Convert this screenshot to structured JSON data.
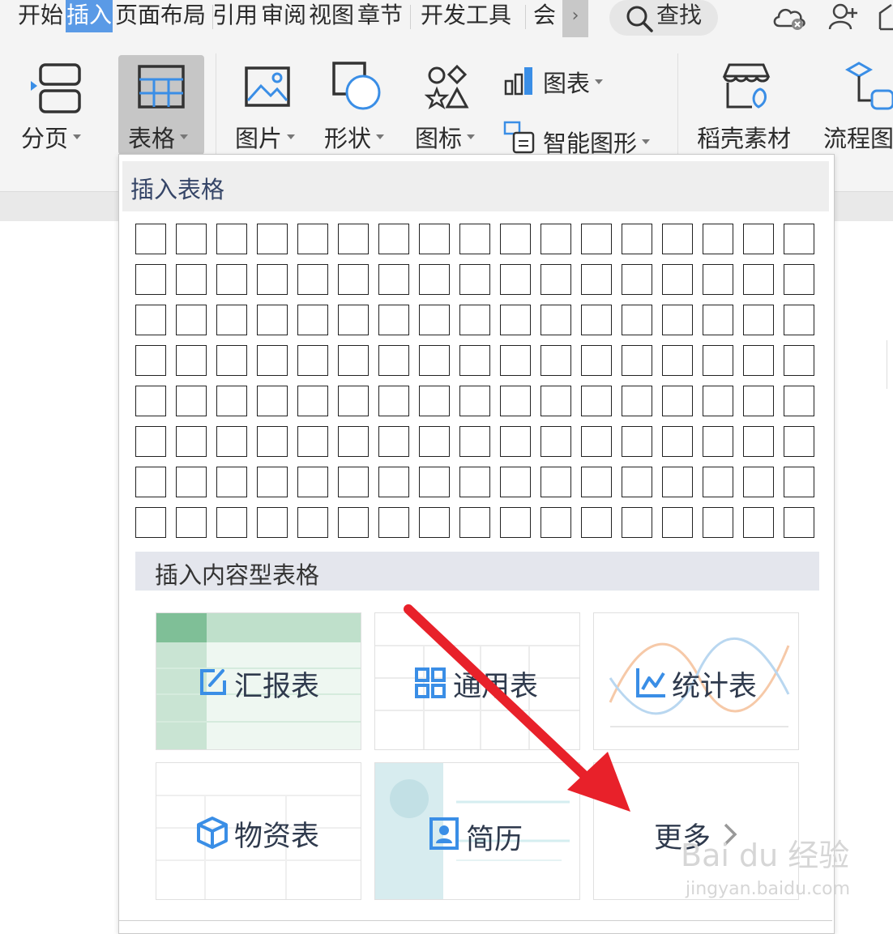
{
  "tabs": [
    {
      "label": "开始"
    },
    {
      "label": "插入"
    },
    {
      "label": "页面布局"
    },
    {
      "label": "引用"
    },
    {
      "label": "审阅"
    },
    {
      "label": "视图"
    },
    {
      "label": "章节"
    },
    {
      "label": "开发工具"
    },
    {
      "label": "会"
    }
  ],
  "search": {
    "label": "查找"
  },
  "ribbon": {
    "page_break": "分页",
    "table": "表格",
    "picture": "图片",
    "shape": "形状",
    "icon": "图标",
    "chart": "图表",
    "smart_art": "智能图形",
    "materials": "稻壳素材",
    "flowchart": "流程图"
  },
  "panel": {
    "title": "插入表格",
    "grid": {
      "rows": 8,
      "cols": 17
    },
    "content_title": "插入内容型表格",
    "cards": [
      {
        "label": "汇报表"
      },
      {
        "label": "通用表"
      },
      {
        "label": "统计表"
      },
      {
        "label": "物资表"
      },
      {
        "label": "简历"
      },
      {
        "label": "更多"
      }
    ]
  },
  "watermark": {
    "brand": "Bai du 经验",
    "url": "jingyan.baidu.com"
  },
  "colors": {
    "accent": "#5a9ae6",
    "icon_blue": "#3a8ee6",
    "arrow_red": "#e8212a",
    "panel_header": "#eeeeee",
    "sub_header": "#e4e6ed"
  }
}
